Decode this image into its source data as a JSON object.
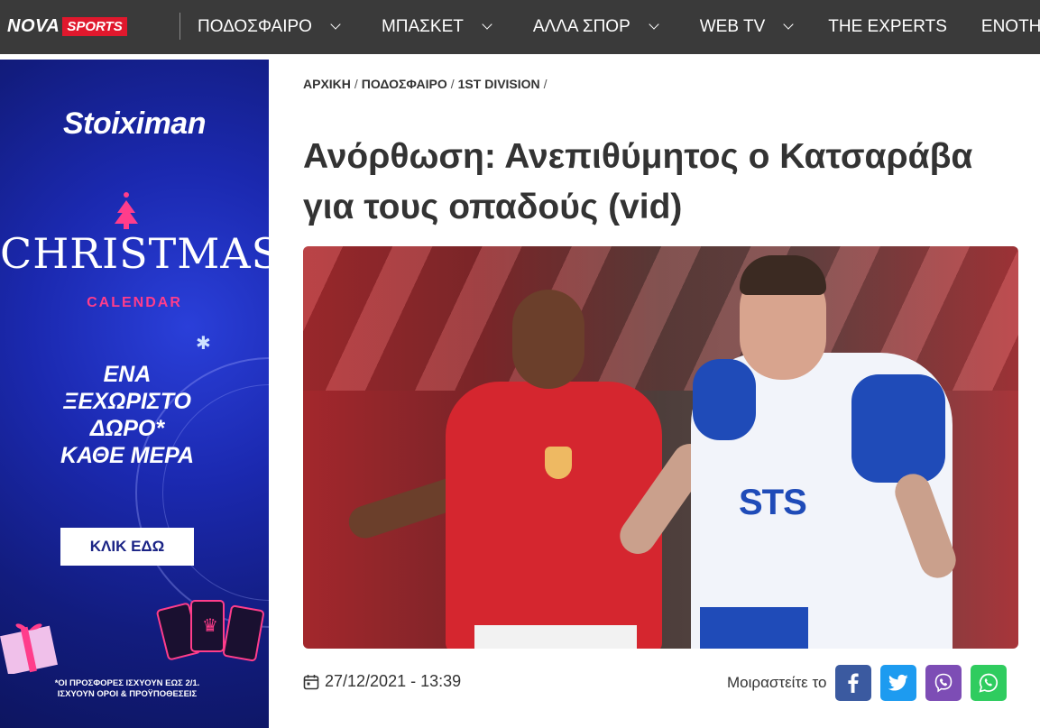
{
  "header": {
    "logo_main": "NOVA",
    "logo_sub": "SPORTS",
    "nav": [
      {
        "label": "ΠΟΔΟΣΦΑΙΡΟ",
        "has_dropdown": true
      },
      {
        "label": "ΜΠΑΣΚΕΤ",
        "has_dropdown": true
      },
      {
        "label": "ΑΛΛΑ ΣΠΟΡ",
        "has_dropdown": true
      },
      {
        "label": "WEB TV",
        "has_dropdown": true
      },
      {
        "label": "THE EXPERTS",
        "has_dropdown": false
      },
      {
        "label": "ΕΝΟΤΗ",
        "has_dropdown": false
      }
    ]
  },
  "ad": {
    "brand": "Stoiximan",
    "christmas": "CHRISTMAS",
    "calendar": "CALENDAR",
    "promo_line1": "ΕΝΑ",
    "promo_line2": "ΞΕΧΩΡΙΣΤΟ",
    "promo_line3": "ΔΩΡΟ*",
    "promo_line4": "ΚΑΘΕ ΜΕΡΑ",
    "cta": "ΚΛΙΚ ΕΔΩ",
    "fine_line1": "*ΟΙ ΠΡΟΣΦΟΡΕΣ ΙΣΧΥΟΥΝ ΕΩΣ 2/1.",
    "fine_line2": "ΙΣΧΥΟΥΝ ΟΡΟΙ & ΠΡΟΫΠΟΘΕΣΕΙΣ"
  },
  "breadcrumb": [
    "ΑΡΧΙΚΗ",
    "ΠΟΔΟΣΦΑΙΡΟ",
    "1ST DIVISION"
  ],
  "breadcrumb_sep": "/",
  "article": {
    "title": "Ανόρθωση: Ανεπιθύμητος ο Κατσαράβα για τους οπαδούς (vid)",
    "image_alt": "Football players in action",
    "date": "27/12/2021",
    "time": "13:39",
    "sts_logo": "STS"
  },
  "share": {
    "label": "Μοιραστείτε το",
    "buttons": [
      {
        "name": "facebook",
        "color": "#3b5aa0"
      },
      {
        "name": "twitter",
        "color": "#1d9bf0"
      },
      {
        "name": "viber",
        "color": "#7d4db5"
      },
      {
        "name": "whatsapp",
        "color": "#2fcc5f"
      }
    ]
  },
  "colors": {
    "topbar": "#3a3a3a",
    "brand_red": "#e0182d",
    "ad_blue": "#1b29b0",
    "text": "#333333"
  }
}
